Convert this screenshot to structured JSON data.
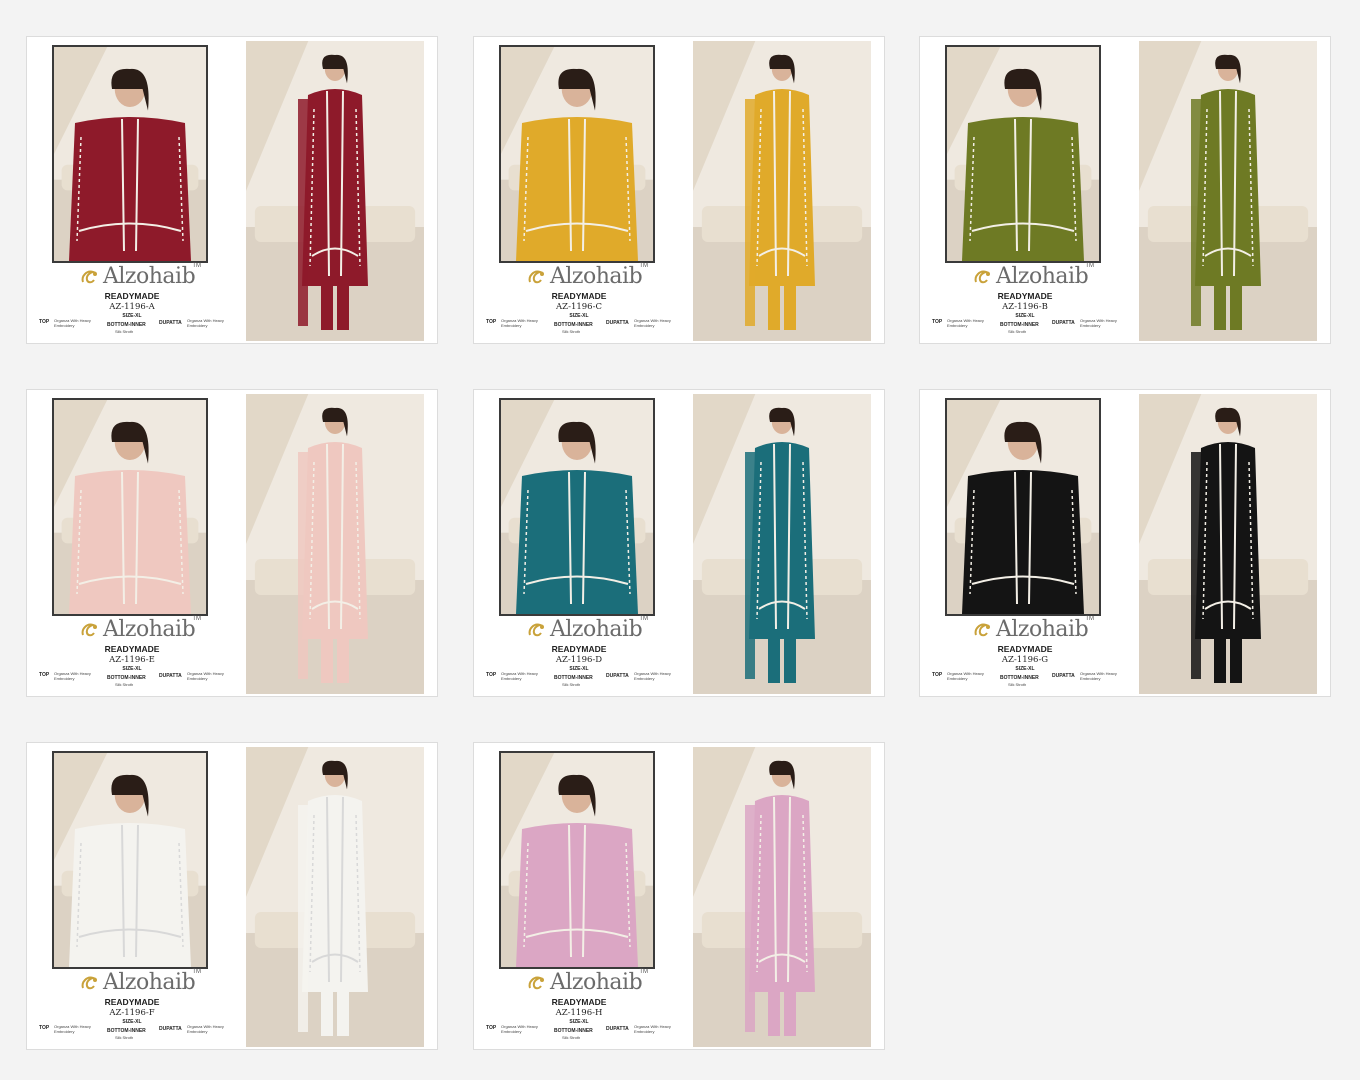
{
  "brand": {
    "name": "Alzohaib",
    "tm": "TM"
  },
  "cards": [
    {
      "readymade": "READYMADE",
      "code": "AZ-1196-A",
      "size": "SIZE-XL",
      "top_label": "TOP",
      "top_value": "Organza With Heavy Embroidery",
      "bottom_label": "BOTTOM-INNER",
      "bottom_value": "Silk Stroth",
      "dupatta_label": "DUPATTA",
      "dupatta_value": "Organza With Heavy Embroidery",
      "color": "#8e1a2a"
    },
    {
      "readymade": "READYMADE",
      "code": "AZ-1196-C",
      "size": "SIZE-XL",
      "top_label": "TOP",
      "top_value": "Organza With Heavy Embroidery",
      "bottom_label": "BOTTOM-INNER",
      "bottom_value": "Silk Stroth",
      "dupatta_label": "DUPATTA",
      "dupatta_value": "Organza With Heavy Embroidery",
      "color": "#e0aa2a"
    },
    {
      "readymade": "READYMADE",
      "code": "AZ-1196-B",
      "size": "SIZE-XL",
      "top_label": "TOP",
      "top_value": "Organza With Heavy Embroidery",
      "bottom_label": "BOTTOM-INNER",
      "bottom_value": "Silk Stroth",
      "dupatta_label": "DUPATTA",
      "dupatta_value": "Organza With Heavy Embroidery",
      "color": "#6e7a24"
    },
    {
      "readymade": "READYMADE",
      "code": "AZ-1196-E",
      "size": "SIZE-XL",
      "top_label": "TOP",
      "top_value": "Organza With Heavy Embroidery",
      "bottom_label": "BOTTOM-INNER",
      "bottom_value": "Silk Stroth",
      "dupatta_label": "DUPATTA",
      "dupatta_value": "Organza With Heavy Embroidery",
      "color": "#efc8c0"
    },
    {
      "readymade": "READYMADE",
      "code": "AZ-1196-D",
      "size": "SIZE-XL",
      "top_label": "TOP",
      "top_value": "Organza With Heavy Embroidery",
      "bottom_label": "BOTTOM-INNER",
      "bottom_value": "Silk Stroth",
      "dupatta_label": "DUPATTA",
      "dupatta_value": "Organza With Heavy Embroidery",
      "color": "#1b6e7a"
    },
    {
      "readymade": "READYMADE",
      "code": "AZ-1196-G",
      "size": "SIZE-XL",
      "top_label": "TOP",
      "top_value": "Organza With Heavy Embroidery",
      "bottom_label": "BOTTOM-INNER",
      "bottom_value": "Silk Stroth",
      "dupatta_label": "DUPATTA",
      "dupatta_value": "Organza With Heavy Embroidery",
      "color": "#141414"
    },
    {
      "readymade": "READYMADE",
      "code": "AZ-1196-F",
      "size": "SIZE-XL",
      "top_label": "TOP",
      "top_value": "Organza With Heavy Embroidery",
      "bottom_label": "BOTTOM-INNER",
      "bottom_value": "Silk Stroth",
      "dupatta_label": "DUPATTA",
      "dupatta_value": "Organza With Heavy Embroidery",
      "color": "#f4f3ef"
    },
    {
      "readymade": "READYMADE",
      "code": "AZ-1196-H",
      "size": "SIZE-XL",
      "top_label": "TOP",
      "top_value": "Organza With Heavy Embroidery",
      "bottom_label": "BOTTOM-INNER",
      "bottom_value": "Silk Stroth",
      "dupatta_label": "DUPATTA",
      "dupatta_value": "Organza With Heavy Embroidery",
      "color": "#dba6c4"
    }
  ]
}
